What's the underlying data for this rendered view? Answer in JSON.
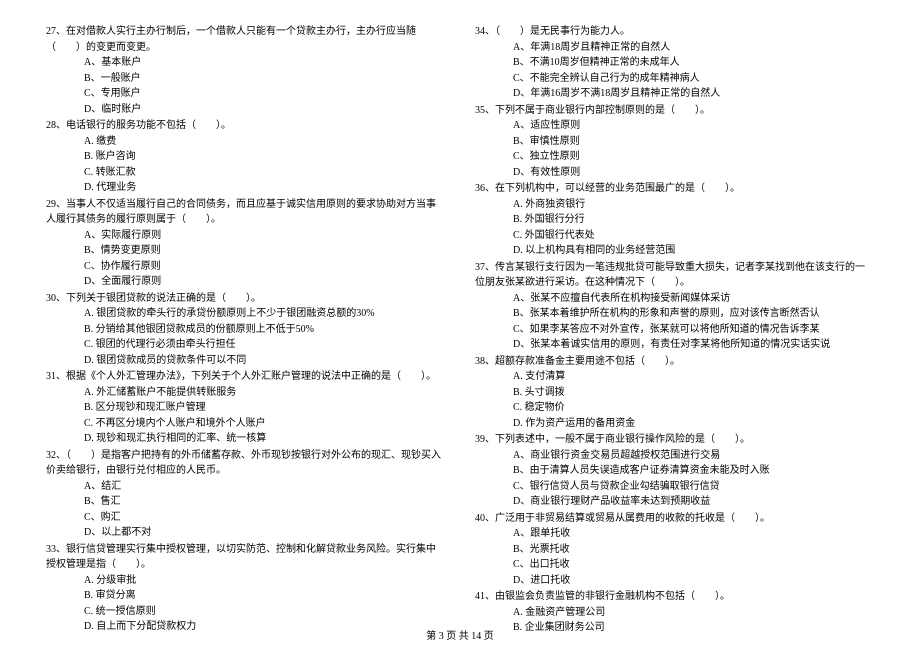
{
  "left": [
    {
      "stem": "27、在对借款人实行主办行制后，一个借款人只能有一个贷款主办行，主办行应当随（　　）的变更而变更。",
      "opts": [
        "A、基本账户",
        "B、一般账户",
        "C、专用账户",
        "D、临时账户"
      ]
    },
    {
      "stem": "28、电话银行的服务功能不包括（　　）。",
      "opts": [
        "A. 缴费",
        "B. 账户咨询",
        "C. 转账汇款",
        "D. 代理业务"
      ]
    },
    {
      "stem": "29、当事人不仅适当履行自己的合同债务，而且应基于诚实信用原则的要求协助对方当事人履行其债务的履行原则属于（　　）。",
      "opts": [
        "A、实际履行原则",
        "B、情势变更原则",
        "C、协作履行原则",
        "D、全面履行原则"
      ]
    },
    {
      "stem": "30、下列关于银团贷款的说法正确的是（　　）。",
      "opts": [
        "A. 银团贷款的牵头行的承贷份额原则上不少于银团融资总额的30%",
        "B. 分销给其他银团贷款成员的份额原则上不低于50%",
        "C. 银团的代理行必须由牵头行担任",
        "D. 银团贷款成员的贷款条件可以不同"
      ]
    },
    {
      "stem": "31、根据《个人外汇管理办法》，下列关于个人外汇账户管理的说法中正确的是（　　）。",
      "opts": [
        "A. 外汇储蓄账户不能提供转账服务",
        "B. 区分现钞和现汇账户管理",
        "C. 不再区分境内个人账户和境外个人账户",
        "D. 现钞和现汇执行相同的汇率、统一核算"
      ]
    },
    {
      "stem": "32、（　　）是指客户把持有的外币储蓄存款、外币现钞按银行对外公布的现汇、现钞买入价卖给银行，由银行兑付相应的人民币。",
      "opts": [
        "A、结汇",
        "B、售汇",
        "C、购汇",
        "D、以上都不对"
      ]
    },
    {
      "stem": "33、银行信贷管理实行集中授权管理，以切实防范、控制和化解贷款业务风险。实行集中授权管理是指（　　）。",
      "opts": [
        "A. 分级审批",
        "B. 审贷分离",
        "C. 统一授信原则",
        "D. 自上而下分配贷款权力"
      ]
    }
  ],
  "right": [
    {
      "stem": "34、（　　）是无民事行为能力人。",
      "opts": [
        "A、年满18周岁且精神正常的自然人",
        "B、不满10周岁但精神正常的未成年人",
        "C、不能完全辨认自己行为的成年精神病人",
        "D、年满16周岁不满18周岁且精神正常的自然人"
      ]
    },
    {
      "stem": "35、下列不属于商业银行内部控制原则的是（　　）。",
      "opts": [
        "A、适应性原则",
        "B、审慎性原则",
        "C、独立性原则",
        "D、有效性原则"
      ]
    },
    {
      "stem": "36、在下列机构中，可以经营的业务范围最广的是（　　）。",
      "opts": [
        "A. 外商独资银行",
        "B. 外国银行分行",
        "C. 外国银行代表处",
        "D. 以上机构具有相同的业务经营范围"
      ]
    },
    {
      "stem": "37、传言某银行支行因为一笔违规批贷可能导致重大损失，记者李某找到他在该支行的一位朋友张某欲进行采访。在这种情况下（　　）。",
      "opts": [
        "A、张某不应擅自代表所在机构接受新闻媒体采访",
        "B、张某本着维护所在机构的形象和声誉的原则，应对该传言断然否认",
        "C、如果李某答应不对外宣传，张某就可以将他所知道的情况告诉李某",
        "D、张某本着诚实信用的原则，有责任对李某将他所知道的情况实话实说"
      ]
    },
    {
      "stem": "38、超额存款准备金主要用途不包括（　　）。",
      "opts": [
        "A. 支付清算",
        "B. 头寸调拨",
        "C. 稳定物价",
        "D. 作为资产运用的备用资金"
      ]
    },
    {
      "stem": "39、下列表述中，一般不属于商业银行操作风险的是（　　）。",
      "opts": [
        "A、商业银行资金交易员超越授权范围进行交易",
        "B、由于清算人员失误造成客户证券清算资金未能及时入账",
        "C、银行信贷人员与贷款企业勾结骗取银行信贷",
        "D、商业银行理财产品收益率未达到预期收益"
      ]
    },
    {
      "stem": "40、广泛用于非贸易结算或贸易从属费用的收款的托收是（　　）。",
      "opts": [
        "A、跟单托收",
        "B、光票托收",
        "C、出口托收",
        "D、进口托收"
      ]
    },
    {
      "stem": "41、由银监会负责监管的非银行金融机构不包括（　　）。",
      "opts": [
        "A. 金融资产管理公司",
        "B. 企业集团财务公司"
      ]
    }
  ],
  "footer": "第 3 页 共 14 页"
}
